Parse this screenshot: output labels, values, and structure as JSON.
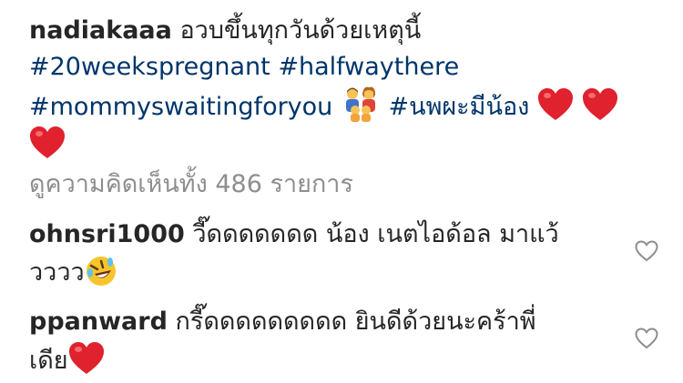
{
  "post": {
    "username": "nadiakaaa",
    "text": "อวบขึ้นทุกวันด้วยเหตุนี้",
    "hashtags": [
      "#20weekspregnant",
      "#halfwaythere",
      "#mommyswaitingforyou",
      "#นพผะมีน้อง"
    ],
    "emoji_icons": [
      "family-emoji",
      "red-heart-emoji",
      "red-heart-emoji",
      "red-heart-emoji"
    ]
  },
  "view_all_comments": "ดูความคิดเห็นทั้ง 486 รายการ",
  "comments": [
    {
      "username": "ohnsri1000",
      "text_line1": "วี๊ดดดดดดด น้อง เนตไอด้อล มาแว้",
      "text_line2": "วววว",
      "emoji": "rolling-laughing-emoji"
    },
    {
      "username": "ppanward",
      "text_line1": "กรี๊ดดดดดดดดด ยินดีด้วยนะคร้าพี่",
      "text_line2": "เดีย",
      "emoji": "red-heart-emoji"
    }
  ],
  "colors": {
    "text": "#262626",
    "hashtag": "#003569",
    "muted": "#8e8e8e",
    "heart": "#e0212e"
  }
}
